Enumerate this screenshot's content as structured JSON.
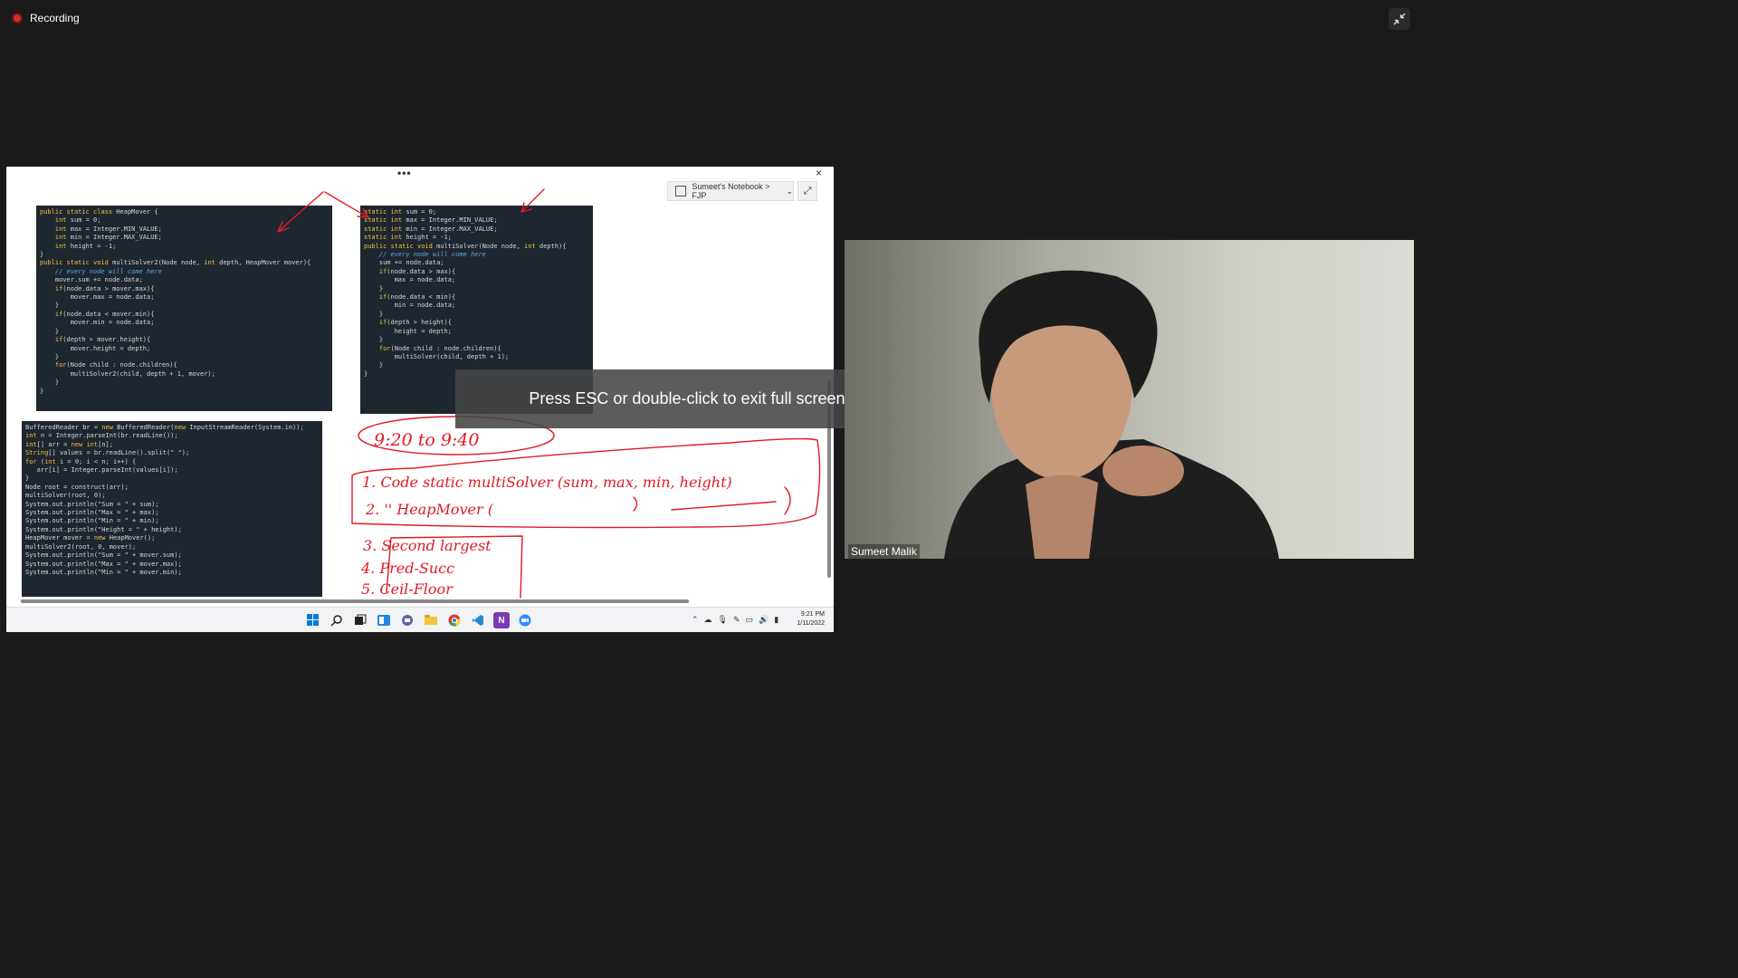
{
  "recording": {
    "label": "Recording"
  },
  "share": {
    "notebook_label": "Sumeet's Notebook > FJP",
    "more_label": "•••",
    "close_label": "×",
    "expand_label": "⤢",
    "code1": [
      "public static class HeapMover {",
      "    int sum = 0;",
      "    int max = Integer.MIN_VALUE;",
      "    int min = Integer.MAX_VALUE;",
      "    int height = -1;",
      "}",
      "public static void multiSolver2(Node node, int depth, HeapMover mover){",
      "    // every node will come here",
      "    mover.sum += node.data;",
      "    if(node.data > mover.max){",
      "        mover.max = node.data;",
      "    }",
      "    if(node.data < mover.min){",
      "        mover.min = node.data;",
      "    }",
      "    if(depth > mover.height){",
      "        mover.height = depth;",
      "    }",
      "    for(Node child : node.children){",
      "        multiSolver2(child, depth + 1, mover);",
      "    }",
      "}"
    ],
    "code2": [
      "static int sum = 0;",
      "static int max = Integer.MIN_VALUE;",
      "static int min = Integer.MAX_VALUE;",
      "static int height = -1;",
      "",
      "public static void multiSolver(Node node, int depth){",
      "    // every node will come here",
      "    sum += node.data;",
      "    if(node.data > max){",
      "        max = node.data;",
      "    }",
      "    if(node.data < min){",
      "        min = node.data;",
      "    }",
      "    if(depth > height){",
      "        height = depth;",
      "    }",
      "",
      "    for(Node child : node.children){",
      "        multiSolver(child, depth + 1);",
      "    }",
      "}"
    ],
    "code3": [
      "BufferedReader br = new BufferedReader(new InputStreamReader(System.in));",
      "int n = Integer.parseInt(br.readLine());",
      "int[] arr = new int[n];",
      "String[] values = br.readLine().split(\" \");",
      "for (int i = 0; i < n; i++) {",
      "   arr[i] = Integer.parseInt(values[i]);",
      "}",
      "",
      "Node root = construct(arr);",
      "multiSolver(root, 0);",
      "System.out.println(\"Sum = \" + sum);",
      "System.out.println(\"Max = \" + max);",
      "System.out.println(\"Min = \" + min);",
      "System.out.println(\"Height = \" + height);",
      "",
      "HeapMover mover = new HeapMover();",
      "multiSolver2(root, 0, mover);",
      "System.out.println(\"Sum = \" + mover.sum);",
      "System.out.println(\"Max = \" + mover.max);",
      "System.out.println(\"Min = \" + mover.min);"
    ],
    "ink_texts": {
      "time": "9:20  to  9:40",
      "item1": "1. Code static multiSolver (sum, max, min, height)",
      "item2": "2.  ''  HeapMover  (",
      "item3": "3. Second largest",
      "item4": "4. Pred-Succ",
      "item5": "5. Ceil-Floor"
    },
    "taskbar": {
      "clock_time": "9:21 PM",
      "clock_date": "1/11/2022",
      "apps": [
        "windows-icon",
        "search-icon",
        "task-view-icon",
        "widgets-icon",
        "chat-icon",
        "file-explorer-icon",
        "chrome-icon",
        "vscode-icon",
        "onenote-icon",
        "zoom-icon"
      ]
    }
  },
  "toast": {
    "text": "Press ESC or double-click to exit full screen mode"
  },
  "video": {
    "participant_name": "Sumeet Malik"
  },
  "colors": {
    "ink": "#e01b24",
    "background": "#1a1a1a",
    "code_bg": "#1e2630",
    "keyword": "#f0c23a"
  }
}
